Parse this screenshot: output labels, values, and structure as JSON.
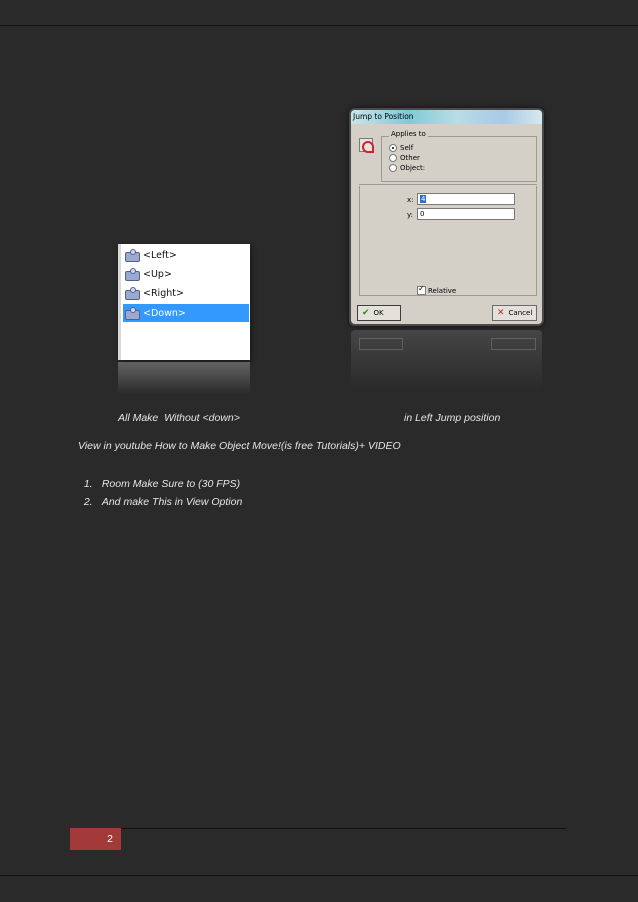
{
  "events_list": {
    "items": [
      {
        "label": "<Left>"
      },
      {
        "label": "<Up>"
      },
      {
        "label": "<Right>"
      },
      {
        "label": "<Down>",
        "selected": true
      }
    ],
    "icon": "keyboard-event-icon"
  },
  "dialog": {
    "title": "Jump to Position",
    "applies_to": {
      "caption": "Applies to",
      "options": [
        "Self",
        "Other",
        "Object:"
      ],
      "selected": "Self"
    },
    "x_label": "x:",
    "x_value": "4",
    "y_label": "y:",
    "y_value": "0",
    "relative_label": "Relative",
    "relative_checked": true,
    "ok_label": "OK",
    "cancel_label": "Cancel"
  },
  "captions": {
    "left": "All Make  Without <down>",
    "right": "in Left Jump position"
  },
  "paragraph": "View in youtube How to Make Object Move!(is free Tutorials)+ VIDEO",
  "numbered_list": [
    {
      "num": "1.",
      "text": "Room Make Sure to (30 FPS)"
    },
    {
      "num": "2.",
      "text": "And make This in View Option"
    }
  ],
  "footer": {
    "page_number": "2"
  },
  "colors": {
    "page_bg": "#2a2a2b",
    "page_number_bg": "#a33a3a",
    "selection": "#3399ff"
  }
}
